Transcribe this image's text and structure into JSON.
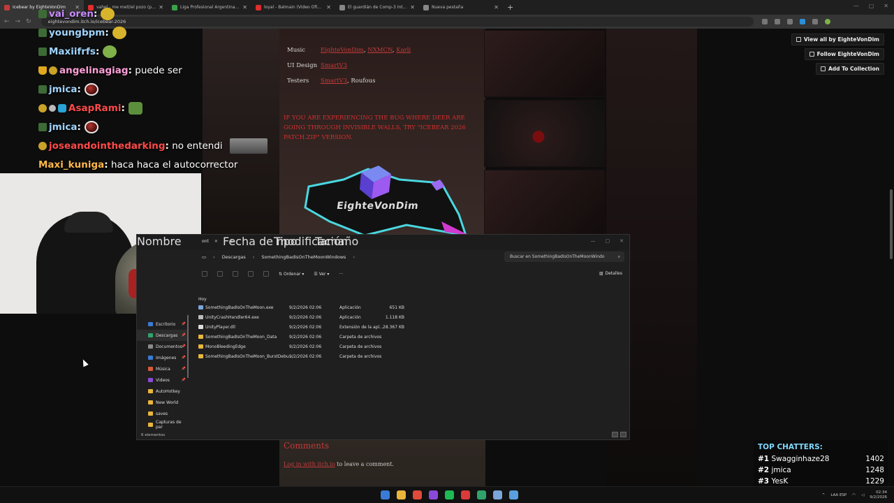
{
  "browser": {
    "tabs": [
      {
        "title": "Icebear by EighteVonDim",
        "favicon": "#c23b3b",
        "active": true
      },
      {
        "title": "vahel - me metí/el pozo (prod.",
        "favicon": "#e02d2d",
        "active": false
      },
      {
        "title": "Liga Profesional Argentina - P.",
        "favicon": "#3aa34a",
        "active": false
      },
      {
        "title": "loyal - Balmain (Video Oficial)",
        "favicon": "#e02d2d",
        "active": false
      },
      {
        "title": "El guardián de Comp-3 Interac",
        "favicon": "#888888",
        "active": false
      },
      {
        "title": "Nueva pestaña",
        "favicon": "#888888",
        "active": false
      }
    ],
    "url": "eightevondim.itch.io/icebear-2026"
  },
  "itch": {
    "credits": [
      {
        "label": "Music",
        "links": [
          "EighteVonDim",
          "NXMCN",
          "Karli"
        ],
        "plain": ""
      },
      {
        "label": "UI Design",
        "links": [
          "SmartV3"
        ],
        "plain": ""
      },
      {
        "label": "Testers",
        "links": [
          "SmartV3"
        ],
        "plain": "Roufous"
      }
    ],
    "bug_notice": "IF YOU ARE EXPERIENCING THE BUG WHERE DEER ARE GOING THROUGH INVISIBLE WALLS, TRY \"Icebear 2026 Patch.zip\" VERSION.",
    "logo_text": "EighteVonDim",
    "comments_title": "Comments",
    "login_link": "Log in with itch.io",
    "login_suffix": " to leave a comment.",
    "side_buttons": [
      "View all by EighteVonDim",
      "Follow EighteVonDim",
      "Add To Collection"
    ]
  },
  "chat": [
    {
      "user": "vai_oren",
      "color": "#c98cff",
      "badges": [
        "mod"
      ],
      "text": "",
      "emote": "yellow"
    },
    {
      "user": "youngbpm",
      "color": "#9fd4ff",
      "badges": [
        "mod"
      ],
      "text": "",
      "emote": "yellow"
    },
    {
      "user": "Maxiifrfs",
      "color": "#9fd4ff",
      "badges": [
        "mod"
      ],
      "text": "",
      "emote": "green"
    },
    {
      "user": "angelinagiag",
      "color": "#ff9ed8",
      "badges": [
        "crown",
        "gold"
      ],
      "text": "puede ser",
      "emote": ""
    },
    {
      "user": "jmica",
      "color": "#9fd4ff",
      "badges": [
        "mod"
      ],
      "text": "",
      "emote": "ball"
    },
    {
      "user": "AsapRami",
      "color": "#ff4a4a",
      "badges": [
        "gold",
        "grey",
        "blue"
      ],
      "text": "",
      "emote": "pepe"
    },
    {
      "user": "jmica",
      "color": "#9fd4ff",
      "badges": [
        "mod"
      ],
      "text": "",
      "emote": "ball"
    },
    {
      "user": "joseandointhedarking",
      "color": "#ff4a4a",
      "badges": [
        "gold"
      ],
      "text": "no entendi",
      "emote": "pic"
    },
    {
      "user": "Maxi_kuniga",
      "color": "#ffb84a",
      "badges": [],
      "text": "haca haca el autocorrector",
      "emote": ""
    }
  ],
  "explorer": {
    "tab_close": "✕",
    "breadcrumb": [
      "Descargas",
      "SomethingBadIsOnTheMoonWindows"
    ],
    "search_placeholder": "Buscar en SomethingBadIsOnTheMoonWindo",
    "sort_label": "Ordenar",
    "view_label": "Ver",
    "details_label": "Detalles",
    "columns": [
      "Nombre",
      "Fecha de modificación",
      "Tipo",
      "Tamaño"
    ],
    "group": "Hoy",
    "files": [
      {
        "name": "SomethingBadIsOnTheMoon.exe",
        "date": "9/2/2026 02:06",
        "type": "Aplicación",
        "size": "651 KB",
        "icon": "#7aa6d9"
      },
      {
        "name": "UnityCrashHandler64.exe",
        "date": "9/2/2026 02:06",
        "type": "Aplicación",
        "size": "1.118 KB",
        "icon": "#bbbbbb"
      },
      {
        "name": "UnityPlayer.dll",
        "date": "9/2/2026 02:06",
        "type": "Extensión de la apl...",
        "size": "28.367 KB",
        "icon": "#dddddd"
      },
      {
        "name": "SomethingBadIsOnTheMoon_Data",
        "date": "9/2/2026 02:06",
        "type": "Carpeta de archivos",
        "size": "",
        "icon": "#e8b63a"
      },
      {
        "name": "MonoBleedingEdge",
        "date": "9/2/2026 02:06",
        "type": "Carpeta de archivos",
        "size": "",
        "icon": "#e8b63a"
      },
      {
        "name": "SomethingBadIsOnTheMoon_BurstDebu...",
        "date": "9/2/2026 02:06",
        "type": "Carpeta de archivos",
        "size": "",
        "icon": "#e8b63a"
      }
    ],
    "nav": [
      {
        "label": "Escritorio",
        "icon": "#3a7bd5",
        "pinned": true,
        "selected": false
      },
      {
        "label": "Descargas",
        "icon": "#2fa36b",
        "pinned": true,
        "selected": true
      },
      {
        "label": "Documentos",
        "icon": "#8a8a8a",
        "pinned": true,
        "selected": false
      },
      {
        "label": "Imágenes",
        "icon": "#3a7bd5",
        "pinned": true,
        "selected": false
      },
      {
        "label": "Música",
        "icon": "#d95a3a",
        "pinned": true,
        "selected": false
      },
      {
        "label": "Videos",
        "icon": "#8a4ad9",
        "pinned": true,
        "selected": false
      },
      {
        "label": "AutoHotkey",
        "icon": "#e8b63a",
        "pinned": false,
        "selected": false
      },
      {
        "label": "New World",
        "icon": "#e8b63a",
        "pinned": false,
        "selected": false
      },
      {
        "label": "saves",
        "icon": "#e8b63a",
        "pinned": false,
        "selected": false
      },
      {
        "label": "Capturas de par",
        "icon": "#e8b63a",
        "pinned": false,
        "selected": false
      }
    ],
    "status": "6 elementos"
  },
  "top_chatters": {
    "title": "TOP CHATTERS:",
    "rows": [
      {
        "rank": "#1",
        "name": "Swagginhaze28",
        "count": "1402"
      },
      {
        "rank": "#2",
        "name": "jmica",
        "count": "1248"
      },
      {
        "rank": "#3",
        "name": "YesK",
        "count": "1229"
      }
    ]
  },
  "taskbar": {
    "apps": [
      "#3a7bd5",
      "#e8b63a",
      "#e04a3a",
      "#8a4ad9",
      "#1db954",
      "#d93a3a",
      "#2fa36b",
      "#7aa6d9",
      "#5aa0e0"
    ],
    "lang": "LAA",
    "lang2": "ESP",
    "time": "02:34",
    "date": "9/2/2026"
  }
}
